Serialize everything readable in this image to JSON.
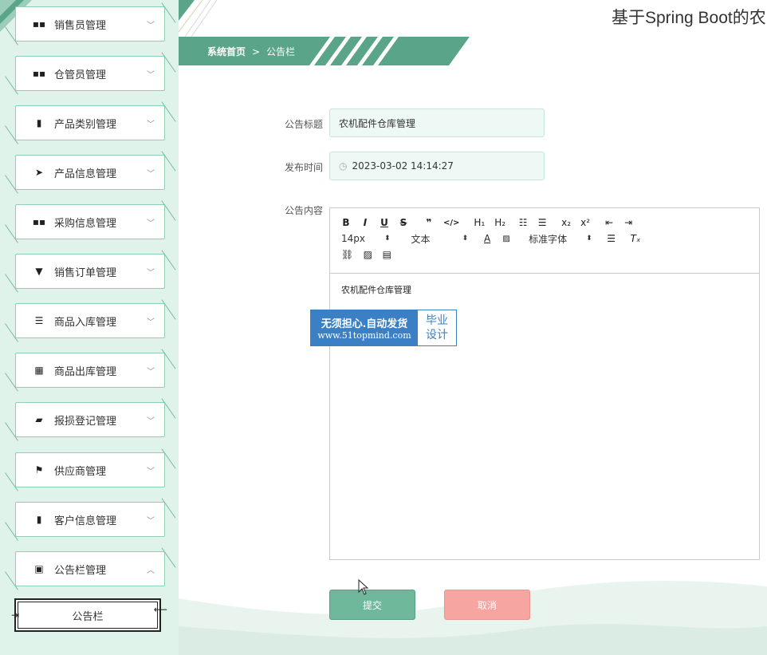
{
  "app": {
    "title": "基于Spring Boot的农"
  },
  "breadcrumb": {
    "home": "系统首页",
    "separator": ">",
    "current": "公告栏"
  },
  "sidebar": {
    "items": [
      {
        "label": "销售员管理",
        "icon": "grid-icon",
        "glyph": "▪▪"
      },
      {
        "label": "仓管员管理",
        "icon": "grid-icon",
        "glyph": "▪▪"
      },
      {
        "label": "产品类别管理",
        "icon": "bar-chart-icon",
        "glyph": "▮"
      },
      {
        "label": "产品信息管理",
        "icon": "send-icon",
        "glyph": "➤"
      },
      {
        "label": "采购信息管理",
        "icon": "grid-icon",
        "glyph": "▪▪"
      },
      {
        "label": "销售订单管理",
        "icon": "pin-icon",
        "glyph": "▼"
      },
      {
        "label": "商品入库管理",
        "icon": "sliders-icon",
        "glyph": "☰"
      },
      {
        "label": "商品出库管理",
        "icon": "apps-icon",
        "glyph": "▦"
      },
      {
        "label": "报损登记管理",
        "icon": "wallet-icon",
        "glyph": "▰"
      },
      {
        "label": "供应商管理",
        "icon": "flag-icon",
        "glyph": "⚑"
      },
      {
        "label": "客户信息管理",
        "icon": "book-icon",
        "glyph": "▮"
      },
      {
        "label": "公告栏管理",
        "icon": "clipboard-icon",
        "glyph": "▣"
      }
    ],
    "sub_item": "公告栏",
    "active_color": "#222222"
  },
  "form": {
    "title_label": "公告标题",
    "title_value": "农机配件仓库管理",
    "time_label": "发布时间",
    "time_value": "2023-03-02 14:14:27",
    "content_label": "公告内容",
    "content_value": "农机配件仓库管理"
  },
  "editor": {
    "font_size": "14px",
    "format": "文本",
    "font_family": "标准字体"
  },
  "watermark": {
    "line1": "无须担心.自动发货",
    "line2": "www.51topmind.com",
    "right1": "毕业",
    "right2": "设计"
  },
  "buttons": {
    "submit": "提交",
    "cancel": "取消"
  },
  "colors": {
    "accent": "#5aa589",
    "sidebar_bg": "#dff3ea",
    "submit": "#6fb89b",
    "cancel": "#f6a5a1"
  }
}
